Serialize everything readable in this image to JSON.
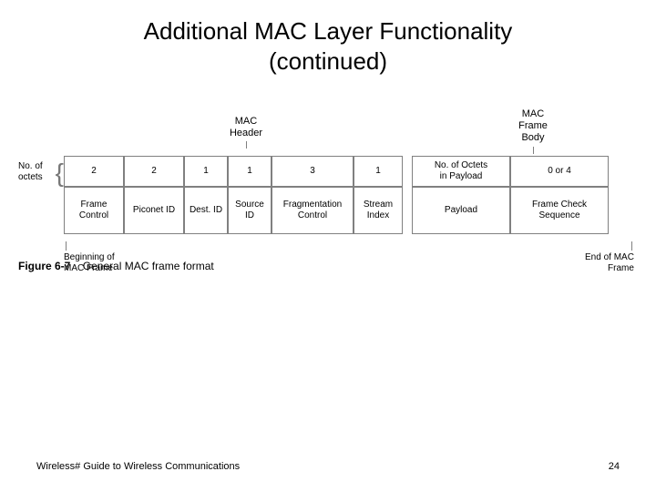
{
  "title_line1": "Additional MAC Layer Functionality",
  "title_line2": "(continued)",
  "top": {
    "header_label": "MAC\nHeader",
    "body_label": "MAC\nFrame\nBody"
  },
  "left_label": "No. of\noctets",
  "row1": {
    "c0": "2",
    "c1": "2",
    "c2": "1",
    "c3": "1",
    "c4": "3",
    "c5": "1",
    "c6": "No. of Octets\nin Payload",
    "c7": "0 or 4"
  },
  "row2": {
    "c0": "Frame\nControl",
    "c1": "Piconet ID",
    "c2": "Dest. ID",
    "c3": "Source\nID",
    "c4": "Fragmentation\nControl",
    "c5": "Stream\nIndex",
    "c6": "Payload",
    "c7": "Frame Check\nSequence"
  },
  "bottom": {
    "begin": "Beginning of\nMAC Frame",
    "end": "End of MAC\nFrame"
  },
  "figure_num": "Figure 6-7",
  "figure_caption": "General MAC frame format",
  "footer_left": "Wireless# Guide to Wireless Communications",
  "footer_right": "24"
}
